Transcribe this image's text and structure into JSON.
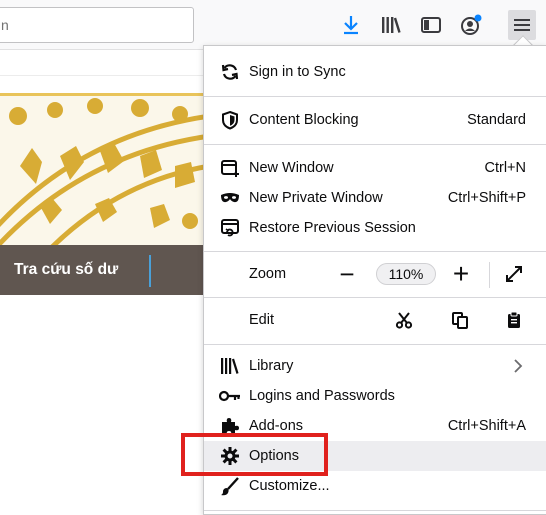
{
  "toolbar": {
    "url_partial": "n",
    "icons": [
      "downloads-icon",
      "library-icon",
      "sidebar-icon",
      "account-icon",
      "hamburger-menu-icon"
    ],
    "accent_color": "#0a84ff"
  },
  "page": {
    "banner_text": "Tra cứu số dư",
    "banner_bg": "#605650",
    "divider_color": "#4aa0d8"
  },
  "menu": {
    "sign_in": "Sign in to Sync",
    "content_blocking": {
      "label": "Content Blocking",
      "value": "Standard"
    },
    "new_window": {
      "label": "New Window",
      "shortcut": "Ctrl+N"
    },
    "new_private_window": {
      "label": "New Private Window",
      "shortcut": "Ctrl+Shift+P"
    },
    "restore_session": {
      "label": "Restore Previous Session"
    },
    "zoom": {
      "label": "Zoom",
      "minus": "−",
      "value": "110%",
      "plus": "+"
    },
    "edit": {
      "label": "Edit"
    },
    "library": {
      "label": "Library"
    },
    "logins": {
      "label": "Logins and Passwords"
    },
    "addons": {
      "label": "Add-ons",
      "shortcut": "Ctrl+Shift+A"
    },
    "options": {
      "label": "Options"
    },
    "customize": {
      "label": "Customize..."
    }
  },
  "highlight_color": "#e0211d"
}
